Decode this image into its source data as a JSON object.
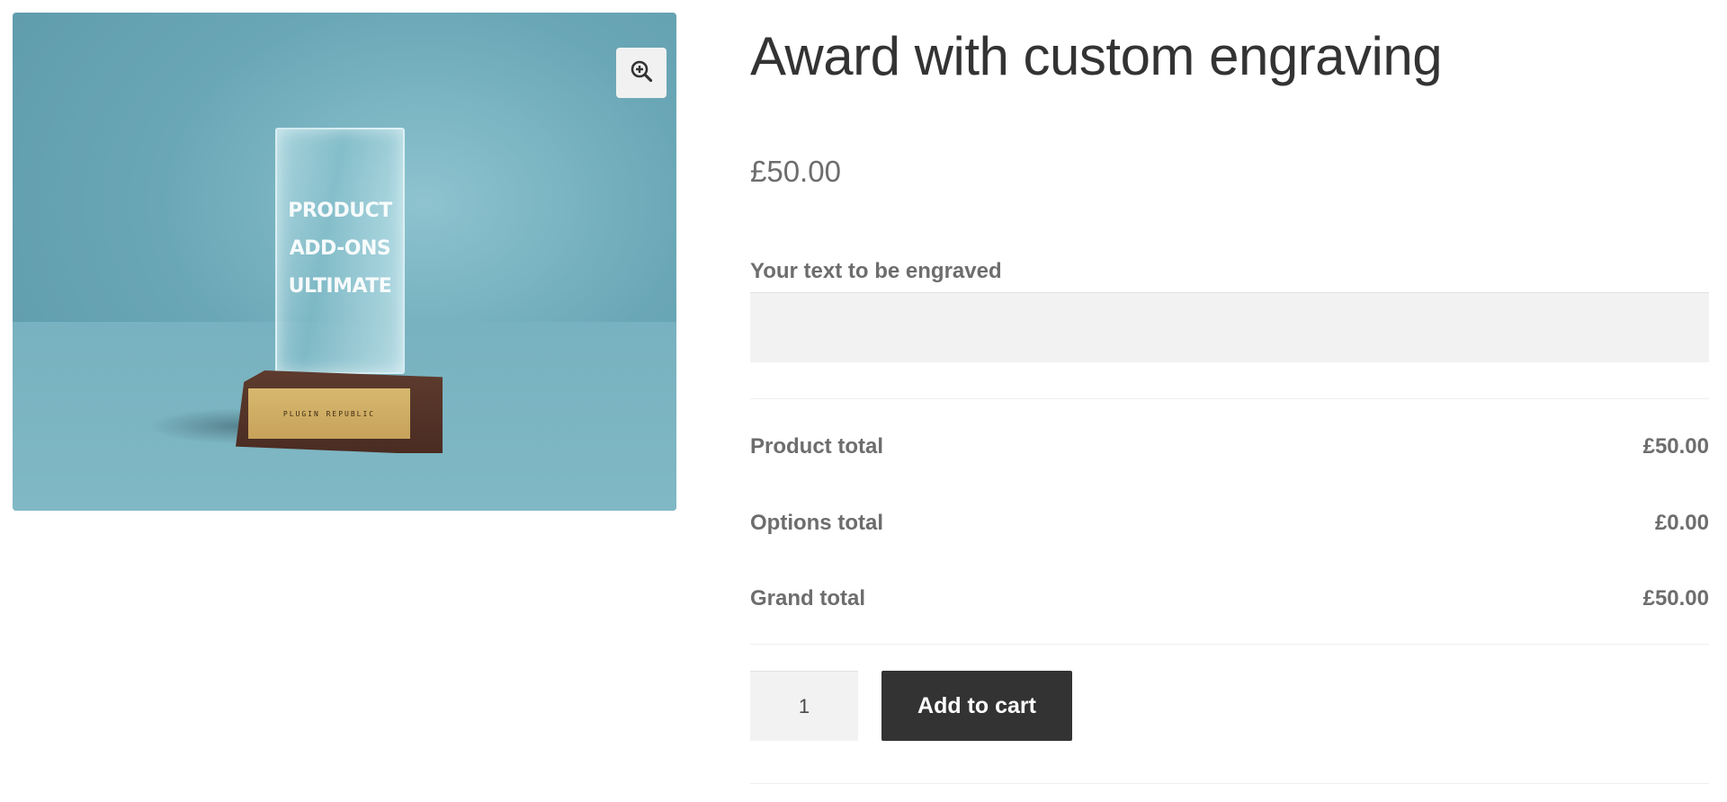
{
  "gallery": {
    "alt": "Award with custom engraving",
    "trophy_text": [
      "PRODUCT",
      "ADD-ONS",
      "ULTIMATE"
    ],
    "plaque_text": "PLUGIN REPUBLIC",
    "zoom_icon": "zoom-in-icon"
  },
  "product": {
    "title": "Award with custom engraving",
    "price": "£50.00"
  },
  "addon": {
    "label": "Your text to be engraved",
    "value": "",
    "placeholder": ""
  },
  "totals": [
    {
      "label": "Product total",
      "value": "£50.00"
    },
    {
      "label": "Options total",
      "value": "£0.00"
    },
    {
      "label": "Grand total",
      "value": "£50.00"
    }
  ],
  "cart": {
    "quantity": "1",
    "button_label": "Add to cart"
  },
  "colors": {
    "button_bg": "#333333",
    "field_bg": "#f2f2f2",
    "text": "#6d6d6d",
    "title": "#333333"
  }
}
